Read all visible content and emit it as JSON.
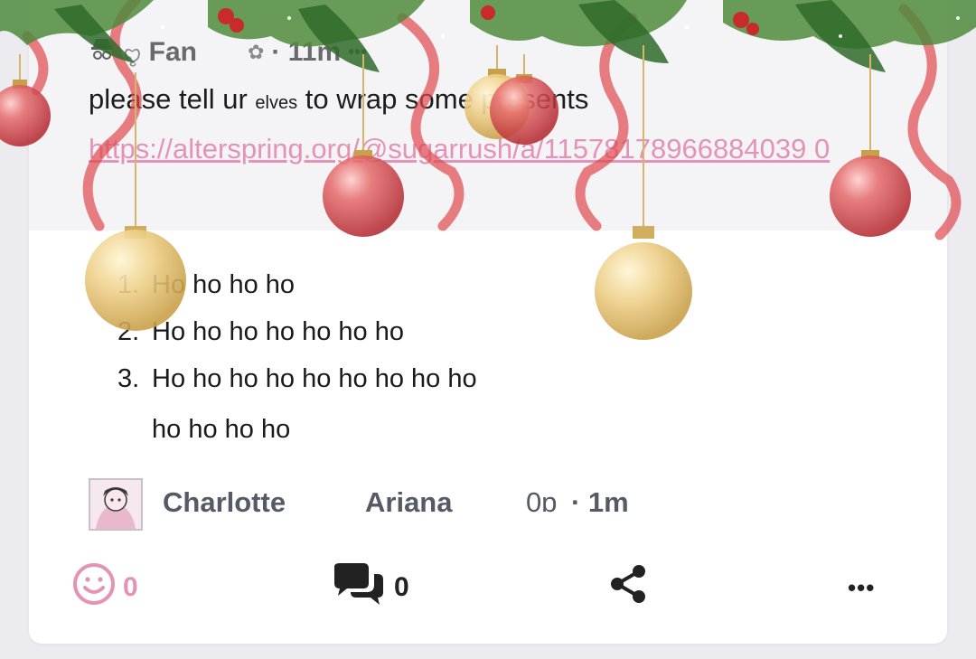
{
  "quoted_post": {
    "author_name": "Fan",
    "author_symbol": "ꨄ",
    "separator_icon": "✿",
    "time": "· 11m",
    "menu": "•••",
    "text_before": "please tell ur",
    "text_small": "elves",
    "text_after": "to wrap some presents",
    "link": "https://alterspring.org/@sugarrush/a/11578178966884039 0"
  },
  "list_items": [
    {
      "num": "1.",
      "text": "Ho ho ho ho"
    },
    {
      "num": "2.",
      "text": "Ho ho ho ho ho ho ho"
    },
    {
      "num": "3.",
      "text": "Ho ho ho ho ho ho ho ho ho"
    },
    {
      "num": "",
      "text": "ho ho ho ho"
    }
  ],
  "author": {
    "name_primary": "Charlotte",
    "name_secondary": "Ariana",
    "handle_fragment": "0ɒ",
    "time": "· 1m"
  },
  "actions": {
    "react_count": "0",
    "comment_count": "0",
    "more": "•••"
  },
  "colors": {
    "accent_pink": "#e493b6",
    "text_gray": "#555a66"
  }
}
